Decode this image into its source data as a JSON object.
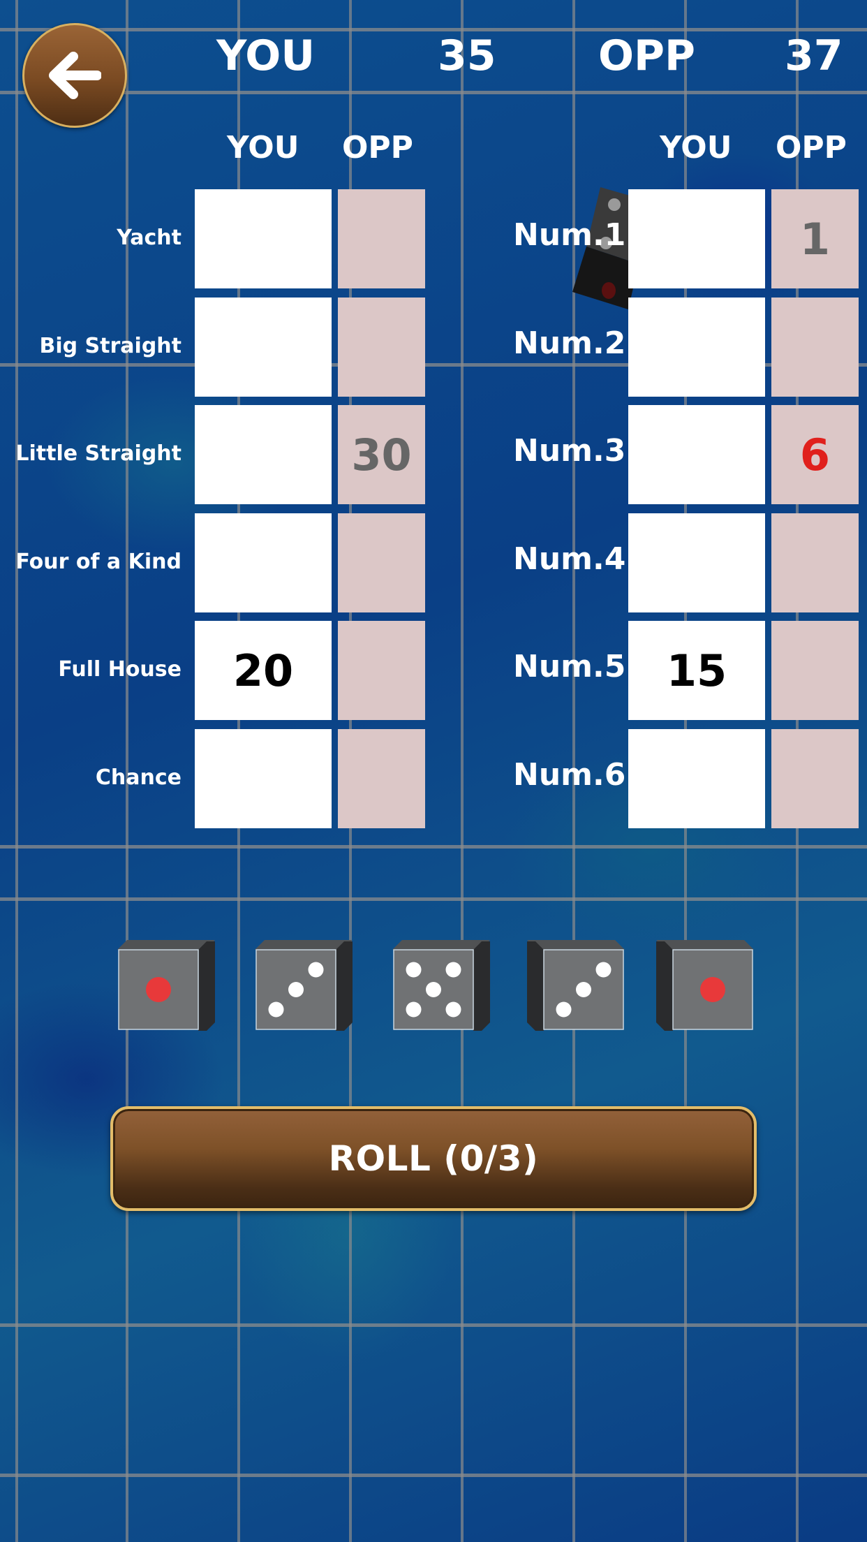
{
  "header": {
    "back_icon": "arrow-left-icon",
    "you_label": "YOU",
    "you_total": "35",
    "opp_label": "OPP",
    "opp_total": "37"
  },
  "scorecard": {
    "left": {
      "col_you": "YOU",
      "col_opp": "OPP",
      "rows": [
        {
          "label": "Yacht",
          "you": "",
          "opp": "",
          "opp_highlight": false
        },
        {
          "label": "Big Straight",
          "you": "",
          "opp": "",
          "opp_highlight": false
        },
        {
          "label": "Little Straight",
          "you": "",
          "opp": "30",
          "opp_highlight": false
        },
        {
          "label": "Four of a Kind",
          "you": "",
          "opp": "",
          "opp_highlight": false
        },
        {
          "label": "Full House",
          "you": "20",
          "opp": "",
          "opp_highlight": false
        },
        {
          "label": "Chance",
          "you": "",
          "opp": "",
          "opp_highlight": false
        }
      ]
    },
    "right": {
      "col_you": "YOU",
      "col_opp": "OPP",
      "rows": [
        {
          "label": "Num.1",
          "you": "",
          "opp": "1",
          "opp_highlight": false
        },
        {
          "label": "Num.2",
          "you": "",
          "opp": "",
          "opp_highlight": false
        },
        {
          "label": "Num.3",
          "you": "",
          "opp": "6",
          "opp_highlight": true
        },
        {
          "label": "Num.4",
          "you": "",
          "opp": "",
          "opp_highlight": false
        },
        {
          "label": "Num.5",
          "you": "15",
          "opp": "",
          "opp_highlight": false
        },
        {
          "label": "Num.6",
          "you": "",
          "opp": "",
          "opp_highlight": false
        }
      ]
    }
  },
  "dice": [
    {
      "value": 1
    },
    {
      "value": 3
    },
    {
      "value": 5
    },
    {
      "value": 3
    },
    {
      "value": 1
    }
  ],
  "roll_button": {
    "label": "ROLL (0/3)",
    "rolls_used": 0,
    "rolls_max": 3
  },
  "colors": {
    "you_cell": "#ffffff",
    "opp_cell": "#dcc7c7",
    "opp_text": "#666666",
    "highlight_text": "#e0201c",
    "button_gold": "#e3bd6a",
    "button_brown": "#7e5128",
    "die_face": "#707274",
    "pip_white": "#ffffff",
    "pip_red": "#e8393a"
  }
}
